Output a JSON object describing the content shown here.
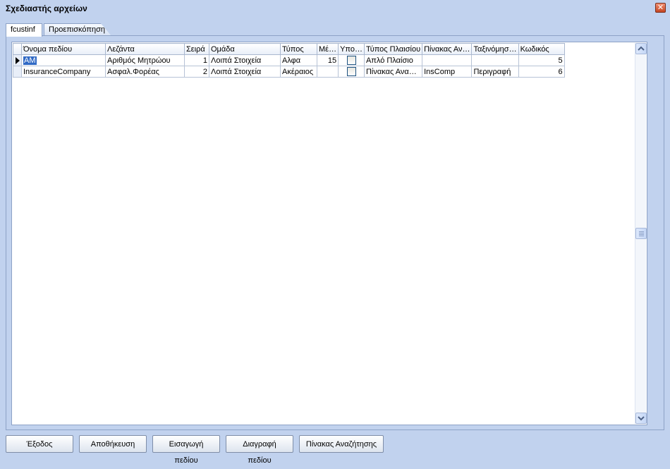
{
  "window": {
    "title": "Σχεδιαστής αρχείων",
    "close_label": "✕"
  },
  "tabs": [
    {
      "label": "fcustinf",
      "active": true
    },
    {
      "label": "Προεπισκόπηση",
      "active": false
    }
  ],
  "grid": {
    "columns": [
      "Όνομα πεδίου",
      "Λεζάντα",
      "Σειρά",
      "Ομάδα",
      "Τύπος",
      "Μέ…",
      "Υπο…",
      "Τύπος Πλαισίου",
      "Πίνακας Αν…",
      "Ταξινόμησ…",
      "Κωδικός"
    ],
    "rows": [
      {
        "current": true,
        "name": "AM",
        "caption": "Αριθμός Μητρώου",
        "order": "1",
        "group": "Λοιπά Στοιχεία",
        "type": "Αλφα",
        "size": "15",
        "required": false,
        "frame_type": "Απλό Πλαίσιο",
        "lookup_table": "",
        "sort": "",
        "code": "5"
      },
      {
        "current": false,
        "name": "InsuranceCompany",
        "caption": "Ασφαλ.Φορέας",
        "order": "2",
        "group": "Λοιπά Στοιχεία",
        "type": "Ακέραιος",
        "size": "",
        "required": false,
        "frame_type": "Πίνακας Ανα…",
        "lookup_table": "InsComp",
        "sort": "Περιγραφή",
        "code": "6"
      }
    ]
  },
  "buttons": {
    "exit": "Έξοδος",
    "save": "Αποθήκευση",
    "insert": "Εισαγωγή πεδίου",
    "delete": "Διαγραφή πεδίου",
    "lookup": "Πίνακας Αναζήτησης"
  },
  "icons": {
    "close": "close-icon",
    "row_indicator": "current-row-arrow-icon",
    "scroll_up": "scroll-up-arrow-icon",
    "scroll_down": "scroll-down-arrow-icon"
  },
  "colors": {
    "background": "#c1d2ee",
    "selection": "#316ac5",
    "close_button": "#c44420"
  }
}
